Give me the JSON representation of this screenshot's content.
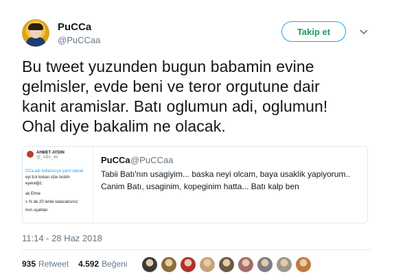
{
  "author": {
    "name": "PuCCa",
    "handle": "@PuCCaa"
  },
  "follow_label": "Takip et",
  "tweet_text": "Bu tweet yuzunden bugun babamin evine\ngelmisler, evde beni ve teror orgutune dair\nkanit aramislar. Batı oglumun adi, oglumun!\nOhal diye bakalim ne olacak.",
  "quoted": {
    "name": "PuCCa",
    "handle": "@PuCCaa",
    "text": "Tabii Batı'nın usagiyim... baska neyi olcam, baya usaklik yapiyorum..\nCanim Batı, usaginim, kopeginim hatta... Batı kalp ben",
    "thumb": {
      "author": "AHMET AYDIN",
      "handle": "@_ABA_48",
      "line1": "CCa adı kullanıcıya yanıt olarak",
      "line2": "eyi b.k kokan size teslim",
      "line3": "eyeceğiz.",
      "line4": "ak Etme",
      "line5": "s % de 20 lerde kalacaksınız",
      "line6": "mın uşakları"
    }
  },
  "timestamp": "11:14 - 28 Haz 2018",
  "stats": {
    "retweets": "935",
    "retweets_label": "Retweet",
    "likes": "4.592",
    "likes_label": "Beğeni"
  },
  "likers": [
    {
      "name": "liker-1",
      "color": "#3a3a3a"
    },
    {
      "name": "liker-2",
      "color": "#8a6d3b"
    },
    {
      "name": "liker-3",
      "color": "#b03030"
    },
    {
      "name": "liker-4",
      "color": "#c9a27a"
    },
    {
      "name": "liker-5",
      "color": "#6b5a45"
    },
    {
      "name": "liker-6",
      "color": "#a66b6b"
    },
    {
      "name": "liker-7",
      "color": "#7a7f86"
    },
    {
      "name": "liker-8",
      "color": "#9a9a8a"
    },
    {
      "name": "liker-9",
      "color": "#c07a3a"
    }
  ],
  "colors": {
    "accent": "#1da1f2",
    "follow_text": "#1b9a5e",
    "muted": "#657786"
  }
}
